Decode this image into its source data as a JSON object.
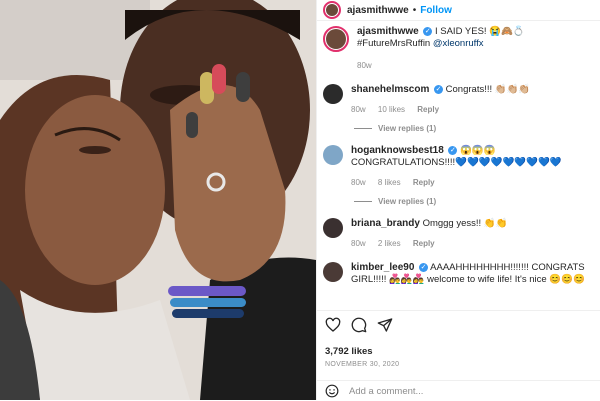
{
  "post": {
    "username": "ajasmithwwe",
    "follow_label": "Follow",
    "caption": "I SAID YES! 😭🙈💍 #FutureMrsRuffin",
    "caption_mention": "@xleonruffx",
    "caption_time": "80w"
  },
  "comments": [
    {
      "username": "shanehelmscom",
      "text": "Congrats!!! 👏🏼👏🏼👏🏼",
      "time": "80w",
      "likes": "10 likes",
      "reply": "Reply",
      "view_replies": "View replies (1)",
      "avatar_color": "#2b2b2b"
    },
    {
      "username": "hoganknowsbest18",
      "text": "😱😱😱CONGRATULATIONS!!!!💙💙💙💙💙💙💙💙💙",
      "time": "80w",
      "likes": "8 likes",
      "reply": "Reply",
      "view_replies": "View replies (1)",
      "avatar_color": "#7fa6c7"
    },
    {
      "username": "briana_brandy",
      "text": "Omggg yess!! 👏👏",
      "time": "80w",
      "likes": "2 likes",
      "reply": "Reply",
      "avatar_color": "#3a3030"
    },
    {
      "username": "kimber_lee90",
      "text": "AAAAHHHHHHHH!!!!!!! CONGRATS GIRL!!!!! 👩‍❤️‍👨👩‍❤️‍👨👩‍❤️‍👨 welcome to wife life! It's nice 😊😊😊",
      "avatar_color": "#4a3a36"
    }
  ],
  "likes_count": "3,792 likes",
  "date": "NOVEMBER 30, 2020",
  "add_comment_placeholder": "Add a comment...",
  "icons": {
    "like": "heart-icon",
    "comment": "comment-icon",
    "share": "share-icon",
    "emoji": "emoji-icon",
    "verified": "verified-badge-icon"
  },
  "colors": {
    "accent": "#0095f6",
    "muted": "#8e8e8e",
    "verified": "#3897f0"
  }
}
